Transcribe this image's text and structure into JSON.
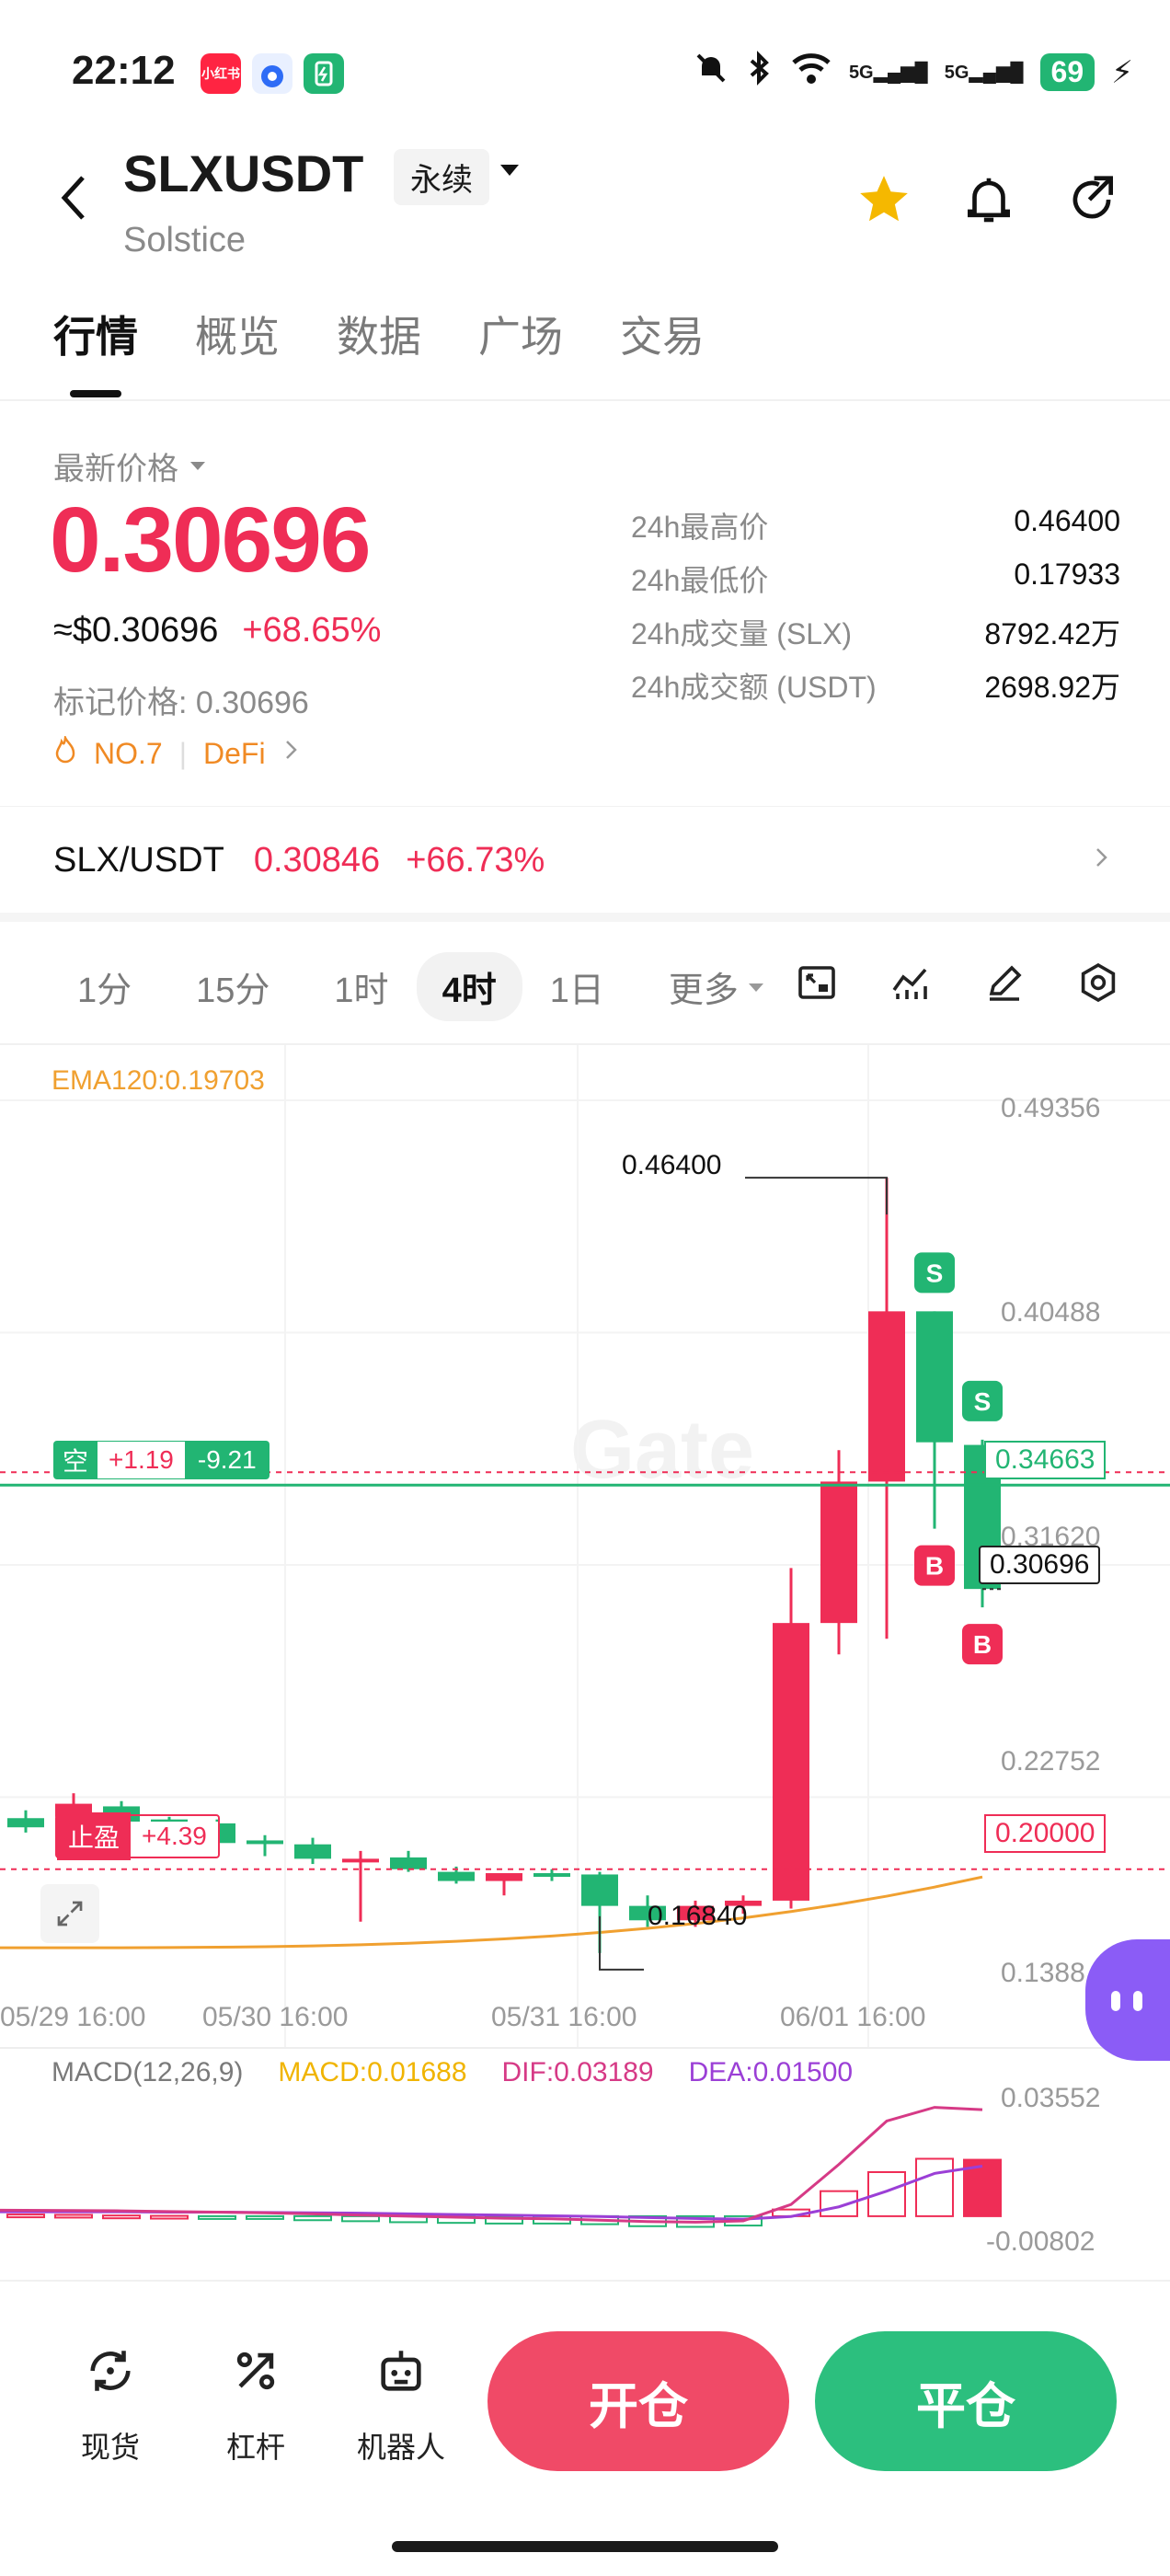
{
  "status_bar": {
    "time": "22:12",
    "battery": "69",
    "net_5g_a": "5G",
    "net_5g_b": "5G",
    "apps": [
      {
        "icon": "xiaohongshu-app-icon",
        "label": "小红书",
        "color": "#ff2442"
      },
      {
        "icon": "baidu-app-icon",
        "label": "",
        "color": "#2e6cf6"
      },
      {
        "icon": "battery-saver-app-icon",
        "label": "",
        "color": "#22b573"
      }
    ]
  },
  "header": {
    "symbol": "SLXUSDT",
    "name": "Solstice",
    "contract_type": "永续"
  },
  "tabs": [
    "行情",
    "概览",
    "数据",
    "广场",
    "交易"
  ],
  "price": {
    "latest_label": "最新价格",
    "value": "0.30696",
    "usd": "≈$0.30696",
    "change": "+68.65%",
    "mark_price": "标记价格: 0.30696",
    "rank_tag": "NO.7",
    "category_tag": "DeFi"
  },
  "stats": [
    {
      "label": "24h最高价",
      "value": "0.46400"
    },
    {
      "label": "24h最低价",
      "value": "0.17933"
    },
    {
      "label": "24h成交量 (SLX)",
      "value": "8792.42万"
    },
    {
      "label": "24h成交额 (USDT)",
      "value": "2698.92万"
    }
  ],
  "spot_pair": {
    "name": "SLX/USDT",
    "price": "0.30846",
    "change": "+66.73%"
  },
  "timeframes": [
    "1分",
    "15分",
    "1时",
    "4时",
    "1日",
    "更多"
  ],
  "chart_data": {
    "type": "candlestick",
    "indicator": "EMA120:0.19703",
    "ema_value": 0.19703,
    "y_ticks": [
      "0.49356",
      "0.40488",
      "0.31620",
      "0.22752",
      "0.1388"
    ],
    "ylim": [
      0.1388,
      0.49356
    ],
    "x_ticks": [
      "05/29 16:00",
      "05/30 16:00",
      "05/31 16:00",
      "06/01 16:00"
    ],
    "high_label": "0.46400",
    "low_label": "0.16840",
    "last_price_tag": "0.30696",
    "position_line": {
      "price": 0.34663,
      "label": "0.34663",
      "side": "空",
      "pnl": "+1.19",
      "pnl_pct": "-9.21"
    },
    "take_profit_line": {
      "price": 0.2,
      "label": "0.20000",
      "text": "止盈",
      "pnl": "+4.39"
    },
    "candles": [
      {
        "o": 0.2195,
        "h": 0.2225,
        "l": 0.214,
        "c": 0.216
      },
      {
        "o": 0.22,
        "h": 0.229,
        "l": 0.215,
        "c": 0.225
      },
      {
        "o": 0.224,
        "h": 0.226,
        "l": 0.216,
        "c": 0.217
      },
      {
        "o": 0.219,
        "h": 0.22,
        "l": 0.215,
        "c": 0.2165
      },
      {
        "o": 0.2175,
        "h": 0.219,
        "l": 0.208,
        "c": 0.21
      },
      {
        "o": 0.211,
        "h": 0.213,
        "l": 0.205,
        "c": 0.2105
      },
      {
        "o": 0.2095,
        "h": 0.212,
        "l": 0.202,
        "c": 0.204
      },
      {
        "o": 0.203,
        "h": 0.207,
        "l": 0.18,
        "c": 0.204
      },
      {
        "o": 0.2045,
        "h": 0.207,
        "l": 0.199,
        "c": 0.2
      },
      {
        "o": 0.199,
        "h": 0.201,
        "l": 0.1945,
        "c": 0.1955
      },
      {
        "o": 0.1955,
        "h": 0.198,
        "l": 0.19,
        "c": 0.1985
      },
      {
        "o": 0.1985,
        "h": 0.2,
        "l": 0.1955,
        "c": 0.1975
      },
      {
        "o": 0.198,
        "h": 0.199,
        "l": 0.168,
        "c": 0.186
      },
      {
        "o": 0.186,
        "h": 0.19,
        "l": 0.178,
        "c": 0.1805
      },
      {
        "o": 0.1805,
        "h": 0.188,
        "l": 0.178,
        "c": 0.186
      },
      {
        "o": 0.186,
        "h": 0.19,
        "l": 0.183,
        "c": 0.188
      },
      {
        "o": 0.188,
        "h": 0.315,
        "l": 0.185,
        "c": 0.294
      },
      {
        "o": 0.294,
        "h": 0.36,
        "l": 0.282,
        "c": 0.348
      },
      {
        "o": 0.348,
        "h": 0.464,
        "l": 0.288,
        "c": 0.413
      },
      {
        "o": 0.413,
        "h": 0.413,
        "l": 0.33,
        "c": 0.363
      },
      {
        "o": 0.362,
        "h": 0.364,
        "l": 0.3,
        "c": 0.307
      }
    ],
    "markers": [
      {
        "candle": 19,
        "kind": "S",
        "pos": "above"
      },
      {
        "candle": 19,
        "kind": "B",
        "pos": "below"
      },
      {
        "candle": 20,
        "kind": "S",
        "pos": "above"
      },
      {
        "candle": 20,
        "kind": "B",
        "pos": "below"
      }
    ],
    "macd": {
      "label": "MACD(12,26,9)",
      "macd": "MACD:0.01688",
      "dif": "DIF:0.03189",
      "dea": "DEA:0.01500",
      "y_ticks": [
        "0.03552",
        "-0.00802"
      ],
      "ylim": [
        -0.00802,
        0.03552
      ],
      "hist": [
        0.0005,
        0.0004,
        0.0002,
        0.0001,
        -0.0004,
        -0.0008,
        -0.0012,
        -0.0015,
        -0.0018,
        -0.002,
        -0.0022,
        -0.0022,
        -0.0024,
        -0.003,
        -0.0032,
        -0.0028,
        0.002,
        0.0075,
        0.0132,
        0.0172,
        0.0169
      ],
      "dif_line": [
        0.0018,
        0.0017,
        0.0016,
        0.0014,
        0.0012,
        0.001,
        0.0007,
        0.0003,
        0.0,
        -0.0003,
        -0.0006,
        -0.0008,
        -0.0012,
        -0.0016,
        -0.0018,
        -0.0014,
        0.0035,
        0.0155,
        0.0285,
        0.0326,
        0.0319
      ],
      "dea_line": [
        0.0013,
        0.0013,
        0.0013,
        0.0012,
        0.0012,
        0.0011,
        0.001,
        0.0009,
        0.0007,
        0.0005,
        0.0003,
        0.0001,
        -0.0001,
        -0.0004,
        -0.0007,
        -0.0009,
        -0.0001,
        0.0028,
        0.0075,
        0.0128,
        0.015
      ]
    }
  },
  "bottom_nav": [
    {
      "icon": "spot-icon",
      "label": "现货"
    },
    {
      "icon": "leverage-icon",
      "label": "杠杆"
    },
    {
      "icon": "robot-icon",
      "label": "机器人"
    }
  ],
  "actions": {
    "open": "开仓",
    "close": "平仓"
  },
  "colors": {
    "up": "#ef2d56",
    "down": "#22b573",
    "ema": "#f0a030",
    "dif": "#d63a86",
    "dea": "#9b3fd6",
    "accent": "#f5b800"
  }
}
